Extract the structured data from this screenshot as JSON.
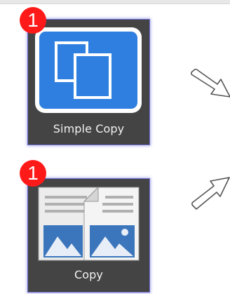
{
  "tiles": [
    {
      "label": "Simple Copy",
      "badge": "1",
      "icon": "simple-copy-icon"
    },
    {
      "label": "Copy",
      "badge": "1",
      "icon": "copy-icon"
    }
  ],
  "arrows": [
    {
      "icon": "arrow-right-down-icon"
    },
    {
      "icon": "arrow-right-up-icon"
    }
  ],
  "colors": {
    "badge": "#ff1a1a",
    "tile_background": "#444444",
    "tile_border": "#6d6fd0",
    "simple_copy_blue": "#2f7fe0",
    "copy_icon_blue": "#2f6fb8"
  }
}
